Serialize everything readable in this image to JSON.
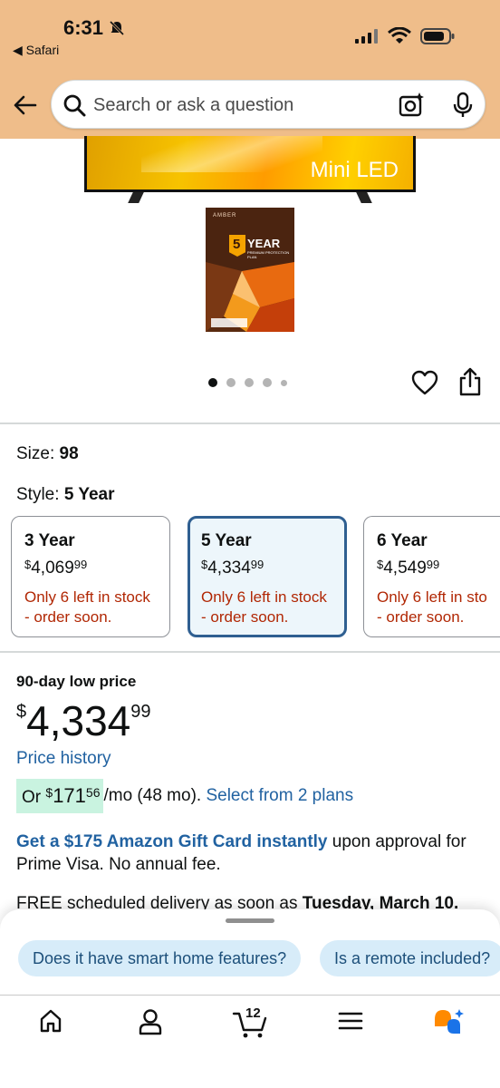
{
  "status_bar": {
    "time": "6:31",
    "back_app": "Safari"
  },
  "search": {
    "placeholder": "Search or ask a question"
  },
  "product_image": {
    "tv_label": "Mini LED",
    "plan_brand": "AMBER",
    "plan_years": "5",
    "plan_word": "YEAR",
    "plan_subtitle": "PREMIUM PROTECTION PLAN"
  },
  "carousel": {
    "total": 5,
    "active": 0
  },
  "size": {
    "label": "Size:",
    "value": "98"
  },
  "style": {
    "label": "Style:",
    "value": "5 Year"
  },
  "options": [
    {
      "title": "3 Year",
      "currency": "$",
      "dollars": "4,069",
      "cents": "99",
      "stock_line1": "Only 6 left in stock",
      "stock_line2": "- order soon."
    },
    {
      "title": "5 Year",
      "currency": "$",
      "dollars": "4,334",
      "cents": "99",
      "stock_line1": "Only 6 left in stock",
      "stock_line2": "- order soon.",
      "selected": true
    },
    {
      "title": "6 Year",
      "currency": "$",
      "dollars": "4,549",
      "cents": "99",
      "stock_line1": "Only 6 left in stock",
      "stock_line2": "- order soon."
    }
  ],
  "price": {
    "low_label": "90-day low price",
    "currency": "$",
    "dollars": "4,334",
    "cents": "99",
    "history_link": "Price history",
    "monthly_prefix": "Or ",
    "monthly_currency": "$",
    "monthly_dollars": "171",
    "monthly_cents": "56",
    "monthly_suffix": "/mo (48 mo). ",
    "plans_link": "Select from 2 plans"
  },
  "gift": {
    "link": "Get a $175 Amazon Gift Card instantly",
    "text": " upon approval for Prime Visa. No annual fee."
  },
  "delivery": {
    "prefix": "FREE scheduled delivery as soon as ",
    "date": "Tuesday, March 10."
  },
  "suggestions": [
    "Does it have smart home features?",
    "Is a remote included?"
  ],
  "nav": {
    "cart_count": "12"
  },
  "colors": {
    "header_bg": "#efbd8a",
    "link": "#2162a1",
    "stock_red": "#b12704",
    "selected_border": "#2f5f91",
    "chip_bg": "#d7ecf9"
  }
}
